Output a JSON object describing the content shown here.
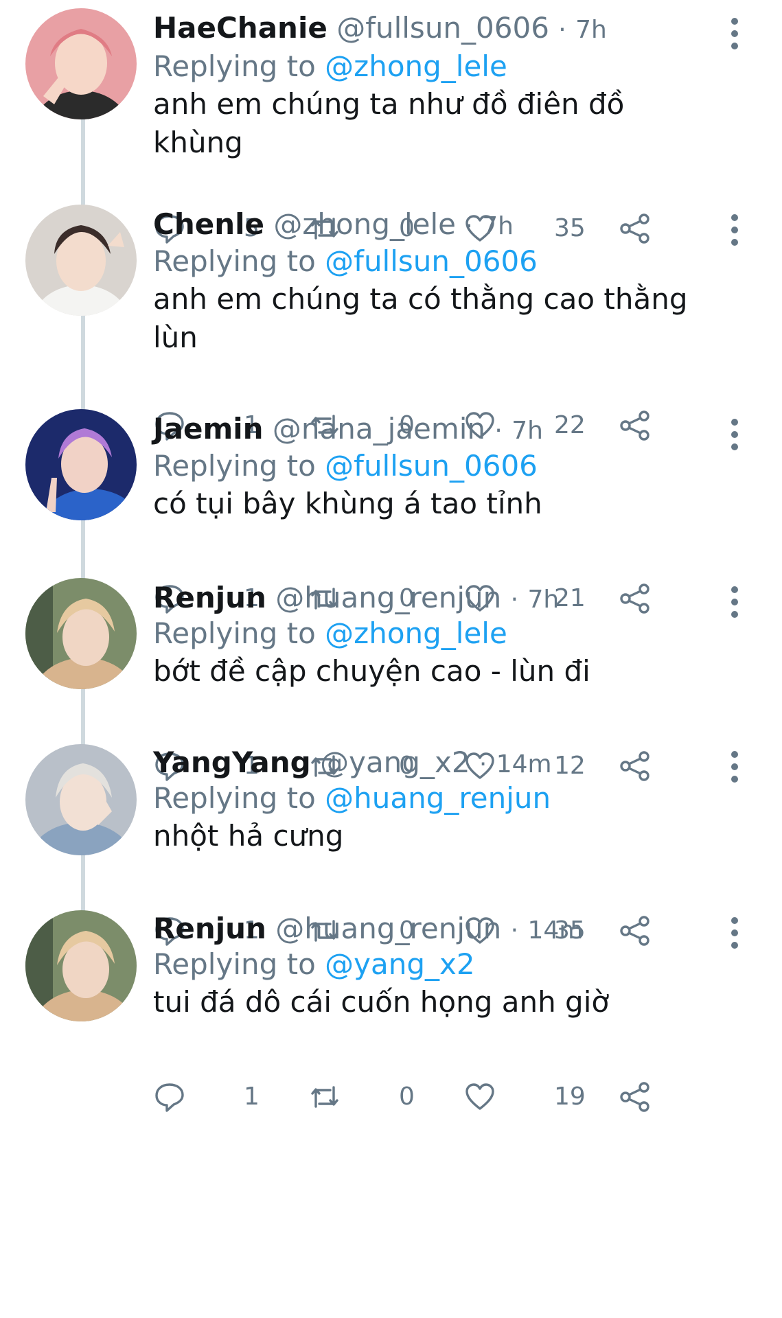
{
  "tweets": [
    {
      "name": "HaeChanie",
      "handle": "@fullsun_0606",
      "separator": "·",
      "time": "7h",
      "replying_label": "Replying to",
      "replying_to": "@zhong_lele",
      "text": "anh em chúng ta như đồ điên đồ khùng",
      "replies": "5",
      "retweets": "0",
      "likes": "35",
      "avatar_color": "#e8a0a4"
    },
    {
      "name": "Chenle",
      "handle": "@zhong_lele",
      "separator": "·",
      "time": "7h",
      "replying_label": "Replying to",
      "replying_to": "@fullsun_0606",
      "text": "anh em chúng ta có thằng cao thằng lùn",
      "replies": "1",
      "retweets": "0",
      "likes": "22",
      "avatar_color": "#d9d4cf"
    },
    {
      "name": "Jaemin",
      "handle": "@nana_jaemin",
      "separator": "·",
      "time": "7h",
      "replying_label": "Replying to",
      "replying_to": "@fullsun_0606",
      "text": "có tụi bây khùng á tao tỉnh",
      "replies": "1",
      "retweets": "0",
      "likes": "21",
      "avatar_color": "#1c2a6b"
    },
    {
      "name": "Renjun",
      "handle": "@huang_renjun",
      "separator": "·",
      "time": "7h",
      "replying_label": "Replying to",
      "replying_to": "@zhong_lele",
      "text": "bớt đề cập chuyện cao - lùn đi",
      "replies": "1",
      "retweets": "0",
      "likes": "12",
      "avatar_color": "#d8b48e"
    },
    {
      "name": "YangYang",
      "handle": "@yang_x2",
      "separator": "·",
      "time": "14m",
      "replying_label": "Replying to",
      "replying_to": "@huang_renjun",
      "text": "nhột hả cưng",
      "replies": "1",
      "retweets": "0",
      "likes": "35",
      "avatar_color": "#b9c0c9"
    },
    {
      "name": "Renjun",
      "handle": "@huang_renjun",
      "separator": "·",
      "time": "14m",
      "replying_label": "Replying to",
      "replying_to": "@yang_x2",
      "text": "tui đá dô cái cuốn họng anh giờ",
      "replies": "1",
      "retweets": "0",
      "likes": "19",
      "avatar_color": "#d8b48e"
    }
  ],
  "colors": {
    "accent": "#1da1f2",
    "secondary_text": "#657786",
    "thread_line": "#cfd9de"
  },
  "icons": {
    "reply": "reply-icon",
    "retweet": "retweet-icon",
    "like": "heart-icon",
    "share": "share-icon",
    "more": "more-vertical-icon"
  }
}
